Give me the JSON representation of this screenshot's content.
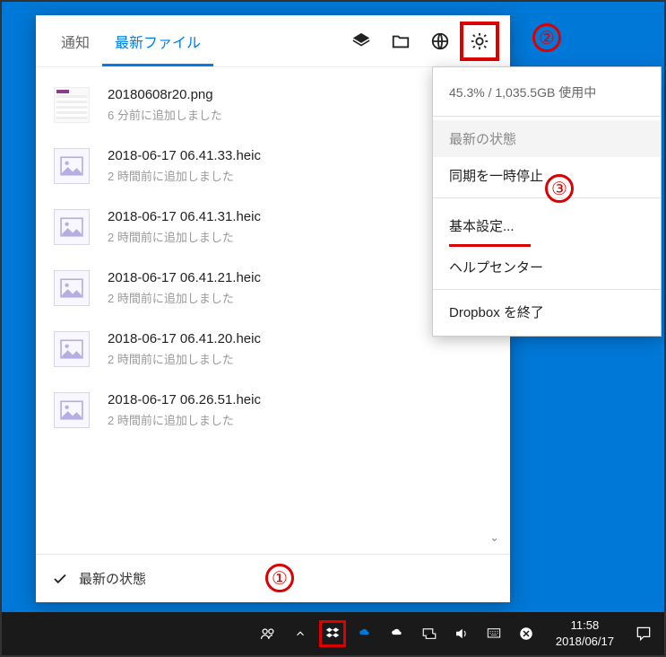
{
  "tabs": {
    "notifications": "通知",
    "recent_files": "最新ファイル"
  },
  "header_icons": {
    "layers": "layers-icon",
    "folder": "folder-icon",
    "globe": "globe-icon",
    "gear": "gear-icon"
  },
  "files": [
    {
      "name": "20180608r20.png",
      "sub": "6 分前に追加しました",
      "thumb": "png"
    },
    {
      "name": "2018-06-17 06.41.33.heic",
      "sub": "2 時間前に追加しました",
      "thumb": "image"
    },
    {
      "name": "2018-06-17 06.41.31.heic",
      "sub": "2 時間前に追加しました",
      "thumb": "image"
    },
    {
      "name": "2018-06-17 06.41.21.heic",
      "sub": "2 時間前に追加しました",
      "thumb": "image"
    },
    {
      "name": "2018-06-17 06.41.20.heic",
      "sub": "2 時間前に追加しました",
      "thumb": "image"
    },
    {
      "name": "2018-06-17 06.26.51.heic",
      "sub": "2 時間前に追加しました",
      "thumb": "image"
    }
  ],
  "status": {
    "text": "最新の状態"
  },
  "menu": {
    "usage": "45.3% / 1,035.5GB 使用中",
    "state": "最新の状態",
    "pause": "同期を一時停止",
    "preferences": "基本設定...",
    "help": "ヘルプセンター",
    "quit": "Dropbox を終了"
  },
  "annotations": {
    "one": "①",
    "two": "②",
    "three": "③"
  },
  "taskbar": {
    "time": "11:58",
    "date": "2018/06/17"
  }
}
